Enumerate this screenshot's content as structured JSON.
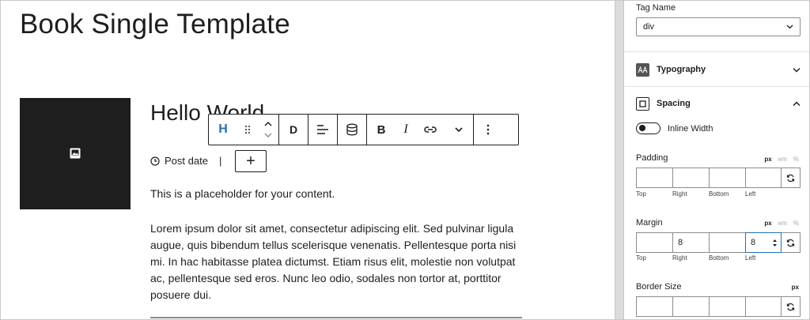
{
  "editor": {
    "page_title": "Book Single Template",
    "post_title": "Hello World",
    "post_date": "Post date",
    "post_date_separator": "|",
    "add_block": "+",
    "placeholder": "This is a placeholder for your content.",
    "body_text": "Lorem ipsum dolor sit amet, consectetur adipiscing elit. Sed pulvinar ligula augue, quis bibendum tellus scelerisque venenatis. Pellentesque porta nisi mi. In hac habitasse platea dictumst. Etiam risus elit, molestie non volutpat ac, pellentesque sed eros. Nunc leo odio, sodales non tortor at, porttitor posuere dui."
  },
  "toolbar": {
    "heading_label": "H",
    "transform_label": "D",
    "bold_label": "B",
    "italic_label": "I",
    "icons": [
      "drag-handle-icon",
      "move-up-down-icon",
      "align-icon",
      "database-icon",
      "link-icon",
      "more-formats-icon",
      "options-icon"
    ]
  },
  "sidebar": {
    "tag_name_label": "Tag Name",
    "tag_name_value": "div",
    "typography_label": "Typography",
    "spacing_label": "Spacing",
    "inline_width_label": "Inline Width",
    "padding": {
      "label": "Padding",
      "units": [
        "px",
        "em",
        "%"
      ],
      "values": [
        "",
        "",
        "",
        ""
      ]
    },
    "margin": {
      "label": "Margin",
      "units": [
        "px",
        "em",
        "%"
      ],
      "values": [
        "",
        "8",
        "",
        "8"
      ]
    },
    "border_size": {
      "label": "Border Size",
      "units": [
        "px"
      ]
    },
    "side_labels": [
      "Top",
      "Right",
      "Bottom",
      "Left"
    ]
  },
  "colors": {
    "accent": "#2271b1",
    "text": "#1e1e1e",
    "featured_bg": "#1e1e1e"
  }
}
